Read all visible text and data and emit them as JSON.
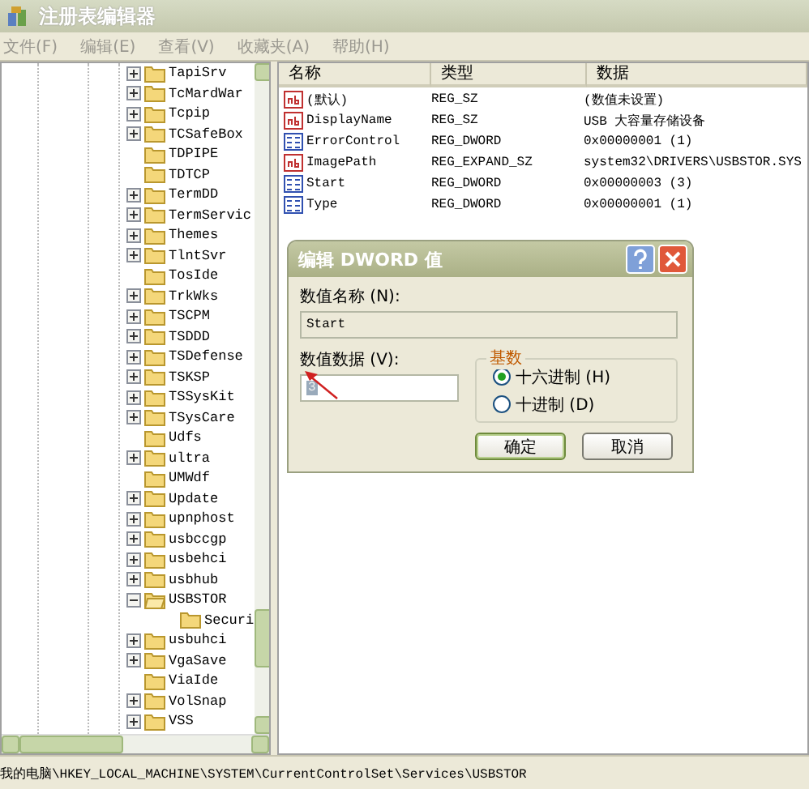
{
  "window": {
    "title": "注册表编辑器"
  },
  "menu": [
    {
      "label": "文件(F)"
    },
    {
      "label": "编辑(E)"
    },
    {
      "label": "查看(V)"
    },
    {
      "label": "收藏夹(A)"
    },
    {
      "label": "帮助(H)"
    }
  ],
  "tree": {
    "items": [
      {
        "label": "TapiSrv",
        "expandable": true,
        "expanded": false
      },
      {
        "label": "TcMardWar",
        "expandable": true,
        "expanded": false
      },
      {
        "label": "Tcpip",
        "expandable": true,
        "expanded": false
      },
      {
        "label": "TCSafeBox",
        "expandable": true,
        "expanded": false
      },
      {
        "label": "TDPIPE",
        "expandable": false,
        "expanded": false
      },
      {
        "label": "TDTCP",
        "expandable": false,
        "expanded": false
      },
      {
        "label": "TermDD",
        "expandable": true,
        "expanded": false
      },
      {
        "label": "TermServic",
        "expandable": true,
        "expanded": false
      },
      {
        "label": "Themes",
        "expandable": true,
        "expanded": false
      },
      {
        "label": "TlntSvr",
        "expandable": true,
        "expanded": false
      },
      {
        "label": "TosIde",
        "expandable": false,
        "expanded": false
      },
      {
        "label": "TrkWks",
        "expandable": true,
        "expanded": false
      },
      {
        "label": "TSCPM",
        "expandable": true,
        "expanded": false
      },
      {
        "label": "TSDDD",
        "expandable": true,
        "expanded": false
      },
      {
        "label": "TSDefense",
        "expandable": true,
        "expanded": false
      },
      {
        "label": "TSKSP",
        "expandable": true,
        "expanded": false
      },
      {
        "label": "TSSysKit",
        "expandable": true,
        "expanded": false
      },
      {
        "label": "TSysCare",
        "expandable": true,
        "expanded": false
      },
      {
        "label": "Udfs",
        "expandable": false,
        "expanded": false
      },
      {
        "label": "ultra",
        "expandable": true,
        "expanded": false
      },
      {
        "label": "UMWdf",
        "expandable": false,
        "expanded": false
      },
      {
        "label": "Update",
        "expandable": true,
        "expanded": false
      },
      {
        "label": "upnphost",
        "expandable": true,
        "expanded": false
      },
      {
        "label": "usbccgp",
        "expandable": true,
        "expanded": false
      },
      {
        "label": "usbehci",
        "expandable": true,
        "expanded": false
      },
      {
        "label": "usbhub",
        "expandable": true,
        "expanded": false
      },
      {
        "label": "USBSTOR",
        "expandable": true,
        "expanded": true,
        "children": [
          {
            "label": "Securi",
            "expandable": false,
            "expanded": false
          }
        ]
      },
      {
        "label": "usbuhci",
        "expandable": true,
        "expanded": false
      },
      {
        "label": "VgaSave",
        "expandable": true,
        "expanded": false
      },
      {
        "label": "ViaIde",
        "expandable": false,
        "expanded": false
      },
      {
        "label": "VolSnap",
        "expandable": true,
        "expanded": false
      },
      {
        "label": "VSS",
        "expandable": true,
        "expanded": false
      }
    ]
  },
  "values": {
    "columns": [
      "名称",
      "类型",
      "数据"
    ],
    "rows": [
      {
        "kind": "string",
        "name": "(默认)",
        "type": "REG_SZ",
        "data": "(数值未设置)"
      },
      {
        "kind": "string",
        "name": "DisplayName",
        "type": "REG_SZ",
        "data": "USB 大容量存储设备"
      },
      {
        "kind": "dword",
        "name": "ErrorControl",
        "type": "REG_DWORD",
        "data": "0x00000001 (1)"
      },
      {
        "kind": "string",
        "name": "ImagePath",
        "type": "REG_EXPAND_SZ",
        "data": "system32\\DRIVERS\\USBSTOR.SYS"
      },
      {
        "kind": "dword",
        "name": "Start",
        "type": "REG_DWORD",
        "data": "0x00000003 (3)"
      },
      {
        "kind": "dword",
        "name": "Type",
        "type": "REG_DWORD",
        "data": "0x00000001 (1)"
      }
    ]
  },
  "dialog": {
    "title": "编辑 DWORD 值",
    "name_label": "数值名称 (N):",
    "name_value": "Start",
    "data_label": "数值数据 (V):",
    "data_value": "3",
    "data_selected": true,
    "base": {
      "title": "基数",
      "options": [
        {
          "label": "十六进制 (H)",
          "selected": true
        },
        {
          "label": "十进制 (D)",
          "selected": false
        }
      ]
    },
    "buttons": [
      {
        "label": "确定",
        "default": true
      },
      {
        "label": "取消",
        "default": false
      }
    ]
  },
  "status_bar": "我的电脑\\HKEY_LOCAL_MACHINE\\SYSTEM\\CurrentControlSet\\Services\\USBSTOR"
}
